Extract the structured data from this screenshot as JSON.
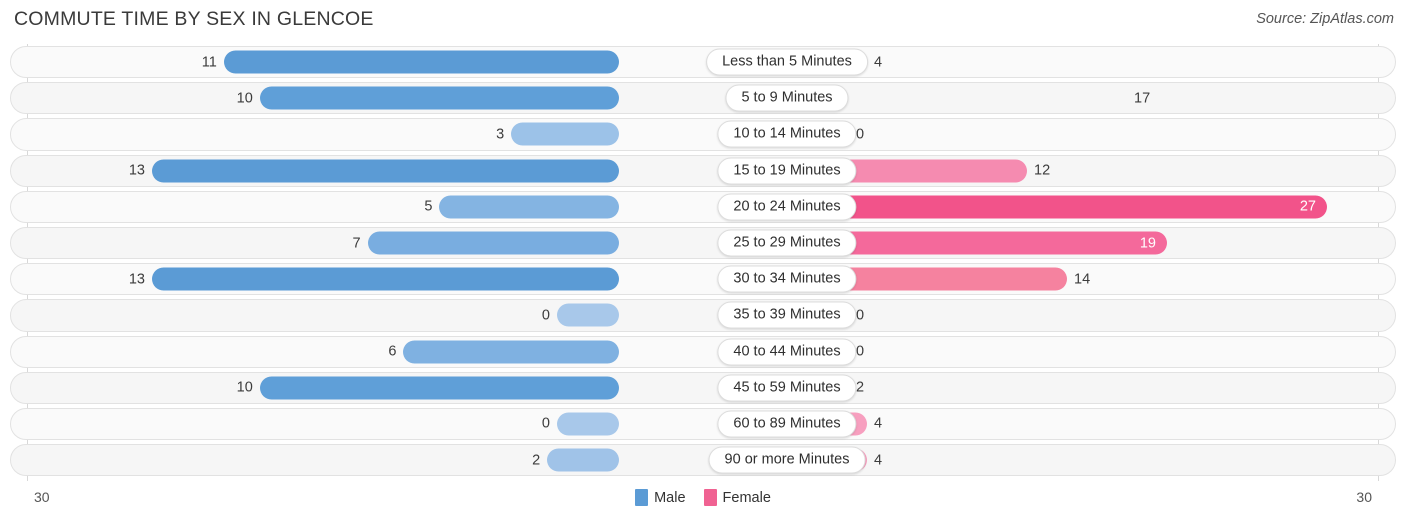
{
  "header": {
    "title": "COMMUTE TIME BY SEX IN GLENCOE",
    "source": "Source: ZipAtlas.com"
  },
  "axis": {
    "left_tick": "30",
    "right_tick": "30",
    "max": 30
  },
  "legend": {
    "items": [
      {
        "label": "Male",
        "color": "#5b9bd5"
      },
      {
        "label": "Female",
        "color": "#f06292"
      }
    ]
  },
  "colors": {
    "male_strong": "#5b9bd5",
    "male_mid": "#6ea9de",
    "male_light": "#a8c8ea",
    "female_strong": "#f25287",
    "female_mid": "#f4traditional",
    "female_light": "#f8a9c5",
    "track_border": "#e2e2e2",
    "track_fill": "#fafafa"
  },
  "chart_data": {
    "type": "bar",
    "orientation": "horizontal-diverging",
    "title": "COMMUTE TIME BY SEX IN GLENCOE",
    "xlabel": "",
    "ylabel": "",
    "xlim": [
      30,
      30
    ],
    "grid": false,
    "legend_position": "bottom-center",
    "categories": [
      "Less than 5 Minutes",
      "5 to 9 Minutes",
      "10 to 14 Minutes",
      "15 to 19 Minutes",
      "20 to 24 Minutes",
      "25 to 29 Minutes",
      "30 to 34 Minutes",
      "35 to 39 Minutes",
      "40 to 44 Minutes",
      "45 to 59 Minutes",
      "60 to 89 Minutes",
      "90 or more Minutes"
    ],
    "series": [
      {
        "name": "Male",
        "values": [
          11,
          10,
          3,
          13,
          5,
          7,
          13,
          0,
          6,
          10,
          0,
          2
        ]
      },
      {
        "name": "Female",
        "values": [
          4,
          17,
          0,
          12,
          27,
          19,
          14,
          0,
          0,
          2,
          4,
          4
        ]
      }
    ]
  },
  "rows": [
    {
      "category": "Less than 5 Minutes",
      "male": "11",
      "female": "4",
      "male_val": 11,
      "female_val": 4,
      "male_color": "#5b9bd5",
      "female_color": "#f79fbf",
      "female_inside": false
    },
    {
      "category": "5 to 9 Minutes",
      "male": "10",
      "female": "17",
      "male_val": 10,
      "female_val": 17,
      "male_color": "#5f9fd8",
      "female_color": "#f4close",
      "female_inside": false
    },
    {
      "category": "10 to 14 Minutes",
      "male": "3",
      "female": "0",
      "male_val": 3,
      "female_val": 0,
      "male_color": "#9cc2e8",
      "female_color": "#f7a3c2",
      "female_inside": false
    },
    {
      "category": "15 to 19 Minutes",
      "male": "13",
      "female": "12",
      "male_val": 13,
      "female_val": 12,
      "male_color": "#5b9bd5",
      "female_color": "#f58bb0",
      "female_inside": false
    },
    {
      "category": "20 to 24 Minutes",
      "male": "5",
      "female": "27",
      "male_val": 5,
      "female_val": 27,
      "male_color": "#84b4e2",
      "female_color": "#f2538a",
      "female_inside": true
    },
    {
      "category": "25 to 29 Minutes",
      "male": "7",
      "female": "19",
      "male_val": 7,
      "female_val": 19,
      "male_color": "#79ade0",
      "female_color": "#f4699b",
      "female_inside": true
    },
    {
      "category": "30 to 34 Minutes",
      "male": "13",
      "female": "14",
      "male_val": 13,
      "female_val": 14,
      "male_color": "#5b9bd5",
      "female_color": "#f5829f",
      "female_inside": false
    },
    {
      "category": "35 to 39 Minutes",
      "male": "0",
      "female": "0",
      "male_val": 0,
      "female_val": 0,
      "male_color": "#a8c8ea",
      "female_color": "#f7a3c2",
      "female_inside": false
    },
    {
      "category": "40 to 44 Minutes",
      "male": "6",
      "female": "0",
      "male_val": 6,
      "female_val": 0,
      "male_color": "#7fb1e1",
      "female_color": "#f7a3c2",
      "female_inside": false
    },
    {
      "category": "45 to 59 Minutes",
      "male": "10",
      "female": "2",
      "male_val": 10,
      "female_val": 2,
      "male_color": "#5f9fd8",
      "female_color": "#f79fbf",
      "female_inside": false
    },
    {
      "category": "60 to 89 Minutes",
      "male": "0",
      "female": "4",
      "male_val": 0,
      "female_val": 4,
      "male_color": "#a8c8ea",
      "female_color": "#f79fbf",
      "female_inside": false
    },
    {
      "category": "90 or more Minutes",
      "male": "2",
      "female": "4",
      "male_val": 2,
      "female_val": 4,
      "male_color": "#a0c3e8",
      "female_color": "#f79fbf",
      "female_inside": false
    }
  ]
}
